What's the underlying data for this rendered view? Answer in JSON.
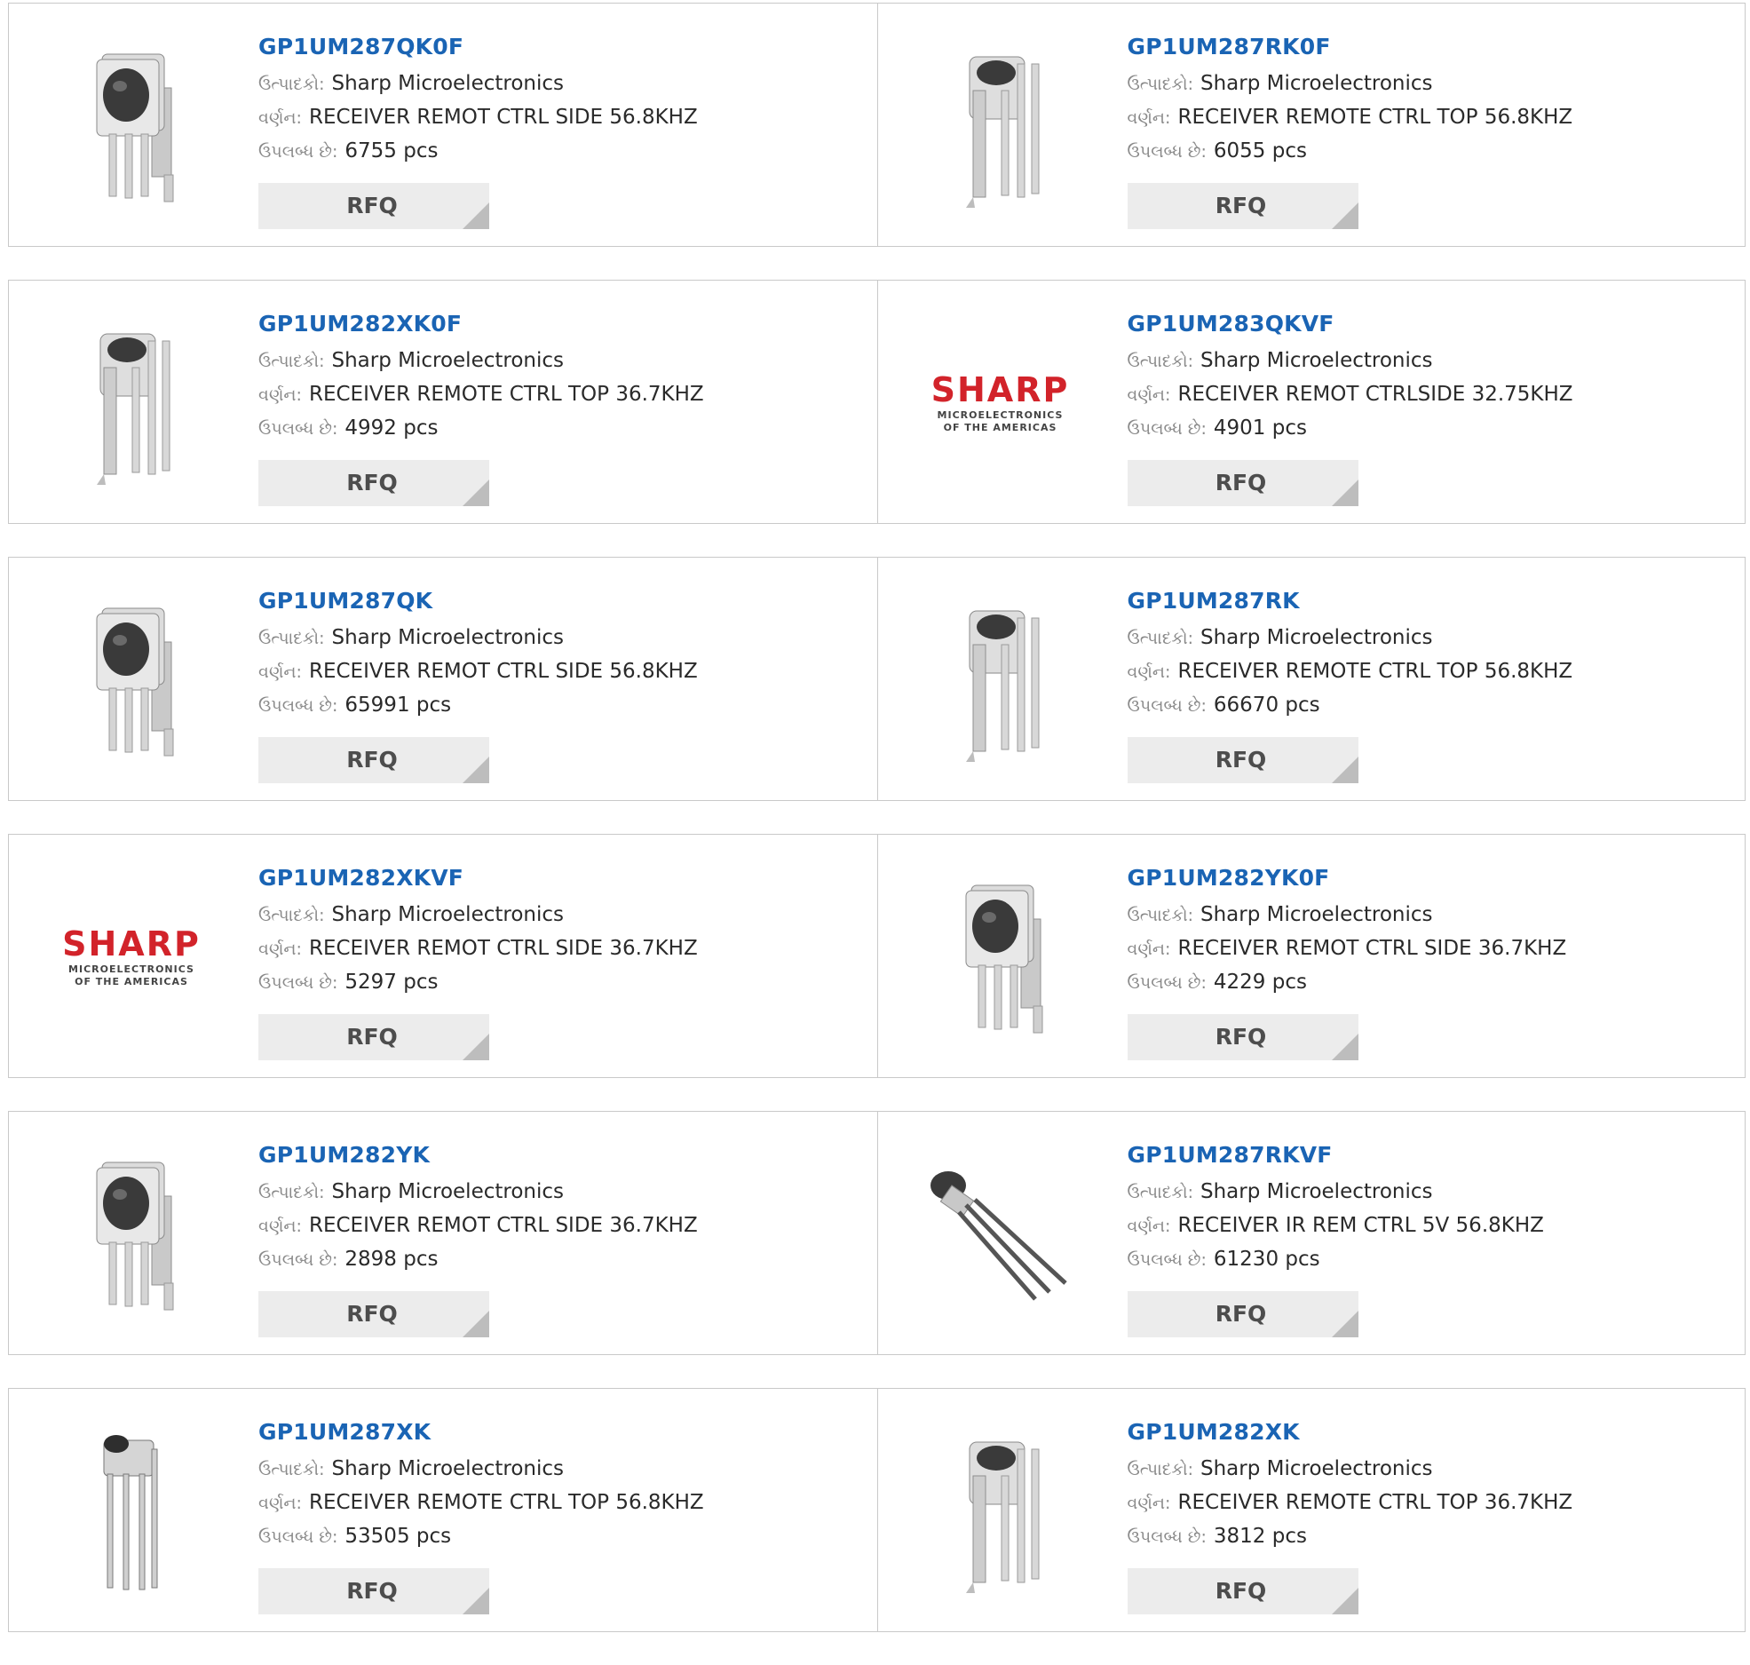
{
  "labels": {
    "manufacturer": "ઉત્પાદકો:",
    "description": "વર્ણન:",
    "available": "ઉપલબ્ધ છે:",
    "rfq": "RFQ"
  },
  "colors": {
    "part_link": "#1a64b4",
    "brand_red": "#d2232a",
    "border": "#c9c9c9",
    "button_bg": "#ececec"
  },
  "logo_text": {
    "brand": "SHARP",
    "line1": "MICROELECTRONICS",
    "line2": "OF THE AMERICAS"
  },
  "products": [
    {
      "part": "GP1UM287QK0F",
      "manufacturer": "Sharp Microelectronics",
      "description": "RECEIVER REMOT CTRL SIDE 56.8KHZ",
      "stock": "6755 pcs",
      "image": "ir-receiver-side-icon"
    },
    {
      "part": "GP1UM287RK0F",
      "manufacturer": "Sharp Microelectronics",
      "description": "RECEIVER REMOTE CTRL TOP 56.8KHZ",
      "stock": "6055 pcs",
      "image": "ir-receiver-top-icon"
    },
    {
      "part": "GP1UM282XK0F",
      "manufacturer": "Sharp Microelectronics",
      "description": "RECEIVER REMOTE CTRL TOP 36.7KHZ",
      "stock": "4992 pcs",
      "image": "ir-receiver-top-icon"
    },
    {
      "part": "GP1UM283QKVF",
      "manufacturer": "Sharp Microelectronics",
      "description": "RECEIVER REMOT CTRLSIDE 32.75KHZ",
      "stock": "4901 pcs",
      "image": "sharp-logo"
    },
    {
      "part": "GP1UM287QK",
      "manufacturer": "Sharp Microelectronics",
      "description": "RECEIVER REMOT CTRL SIDE 56.8KHZ",
      "stock": "65991 pcs",
      "image": "ir-receiver-side-icon"
    },
    {
      "part": "GP1UM287RK",
      "manufacturer": "Sharp Microelectronics",
      "description": "RECEIVER REMOTE CTRL TOP 56.8KHZ",
      "stock": "66670 pcs",
      "image": "ir-receiver-top-icon"
    },
    {
      "part": "GP1UM282XKVF",
      "manufacturer": "Sharp Microelectronics",
      "description": "RECEIVER REMOT CTRL SIDE 36.7KHZ",
      "stock": "5297 pcs",
      "image": "sharp-logo"
    },
    {
      "part": "GP1UM282YK0F",
      "manufacturer": "Sharp Microelectronics",
      "description": "RECEIVER REMOT CTRL SIDE 36.7KHZ",
      "stock": "4229 pcs",
      "image": "ir-receiver-side-icon"
    },
    {
      "part": "GP1UM282YK",
      "manufacturer": "Sharp Microelectronics",
      "description": "RECEIVER REMOT CTRL SIDE 36.7KHZ",
      "stock": "2898 pcs",
      "image": "ir-receiver-side-icon"
    },
    {
      "part": "GP1UM287RKVF",
      "manufacturer": "Sharp Microelectronics",
      "description": "RECEIVER IR REM CTRL 5V 56.8KHZ",
      "stock": "61230 pcs",
      "image": "ir-receiver-angled-icon"
    },
    {
      "part": "GP1UM287XK",
      "manufacturer": "Sharp Microelectronics",
      "description": "RECEIVER REMOTE CTRL TOP 56.8KHZ",
      "stock": "53505 pcs",
      "image": "ir-receiver-slim-icon"
    },
    {
      "part": "GP1UM282XK",
      "manufacturer": "Sharp Microelectronics",
      "description": "RECEIVER REMOTE CTRL TOP 36.7KHZ",
      "stock": "3812 pcs",
      "image": "ir-receiver-top-icon"
    }
  ]
}
